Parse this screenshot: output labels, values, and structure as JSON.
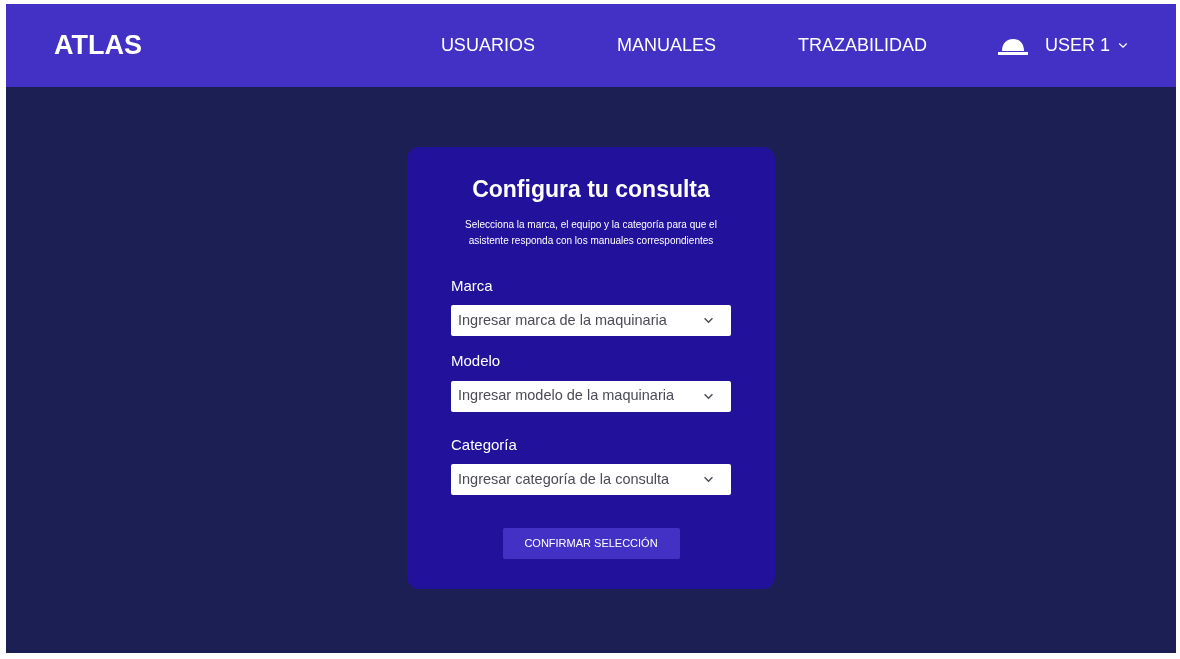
{
  "header": {
    "logo": "ATLAS",
    "nav": [
      {
        "label": "USUARIOS"
      },
      {
        "label": "MANUALES"
      },
      {
        "label": "TRAZABILIDAD"
      }
    ],
    "user": {
      "label": "USER 1"
    }
  },
  "card": {
    "title": "Configura tu consulta",
    "subtitle": "Selecciona la marca, el equipo y la categoría para que el asistente responda con los manuales correspondientes",
    "fields": [
      {
        "label": "Marca",
        "placeholder": "Ingresar marca de la maquinaria"
      },
      {
        "label": "Modelo",
        "placeholder": "Ingresar modelo de la maquinaria"
      },
      {
        "label": "Categoría",
        "placeholder": "Ingresar categoría de la consulta"
      }
    ],
    "button": "CONFIRMAR SELECCIÓN"
  }
}
